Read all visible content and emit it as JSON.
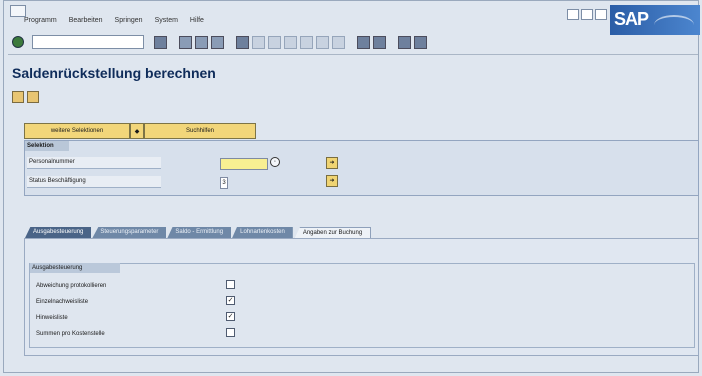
{
  "menu": [
    "Programm",
    "Bearbeiten",
    "Springen",
    "System",
    "Hilfe"
  ],
  "logo": "SAP",
  "title": "Saldenrückstellung berechnen",
  "buttons": {
    "more": "weitere Selektionen",
    "search": "Suchhilfen"
  },
  "selection": {
    "header": "Selektion",
    "rows": [
      {
        "label": "Personalnummer",
        "value": ""
      },
      {
        "label": "Status Beschäftigung",
        "value": "3"
      }
    ]
  },
  "tabs": [
    "Ausgabesteuerung",
    "Steuerungsparameter",
    "Saldo - Ermittlung",
    "Lohnartenkosten",
    "Angaben zur Buchung"
  ],
  "output": {
    "header": "Ausgabesteuerung",
    "checkboxes": [
      {
        "label": "Abweichung protokollieren",
        "checked": false
      },
      {
        "label": "Einzelnachweisliste",
        "checked": true
      },
      {
        "label": "Hinweisliste",
        "checked": true
      },
      {
        "label": "Summen pro Kostenstelle",
        "checked": false
      }
    ]
  }
}
